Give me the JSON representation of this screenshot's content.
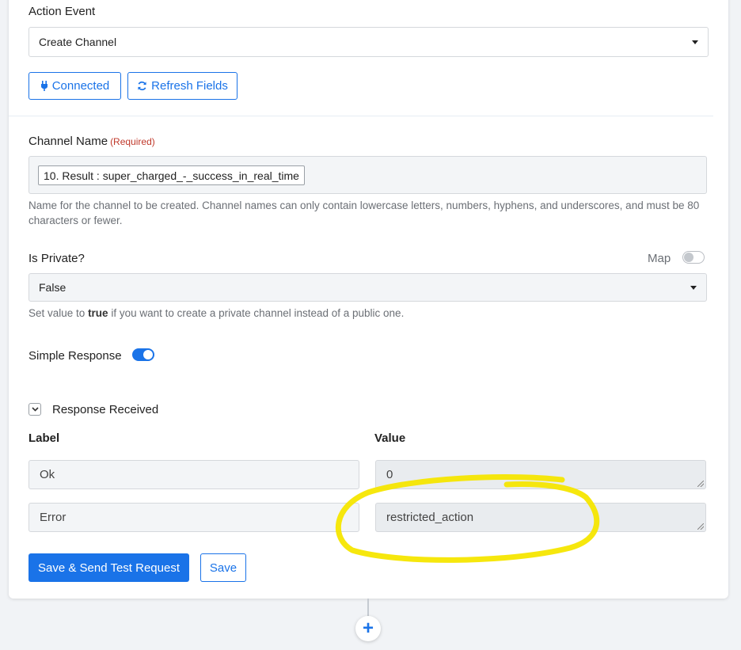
{
  "action_event": {
    "label": "Action Event",
    "selected": "Create Channel"
  },
  "buttons": {
    "connected": "Connected",
    "refresh_fields": "Refresh Fields"
  },
  "channel_name": {
    "label": "Channel Name",
    "required": "(Required)",
    "token": "10. Result : super_charged_-_success_in_real_time",
    "help": "Name for the channel to be created. Channel names can only contain lowercase letters, numbers, hyphens, and underscores, and must be 80 characters or fewer."
  },
  "is_private": {
    "label": "Is Private?",
    "map_label": "Map",
    "map_enabled": false,
    "selected": "False",
    "help_prefix": "Set value to ",
    "help_bold": "true",
    "help_suffix": " if you want to create a private channel instead of a public one."
  },
  "simple_response": {
    "label": "Simple Response",
    "enabled": true
  },
  "response": {
    "toggle_label": "Response Received",
    "label_header": "Label",
    "value_header": "Value",
    "rows": [
      {
        "label": "Ok",
        "value": "0"
      },
      {
        "label": "Error",
        "value": "restricted_action"
      }
    ]
  },
  "footer": {
    "save_send": "Save & Send Test Request",
    "save": "Save",
    "add_step": "+"
  },
  "colors": {
    "accent": "#1a73e8",
    "highlight": "#f5e600",
    "required": "#c0392b"
  }
}
